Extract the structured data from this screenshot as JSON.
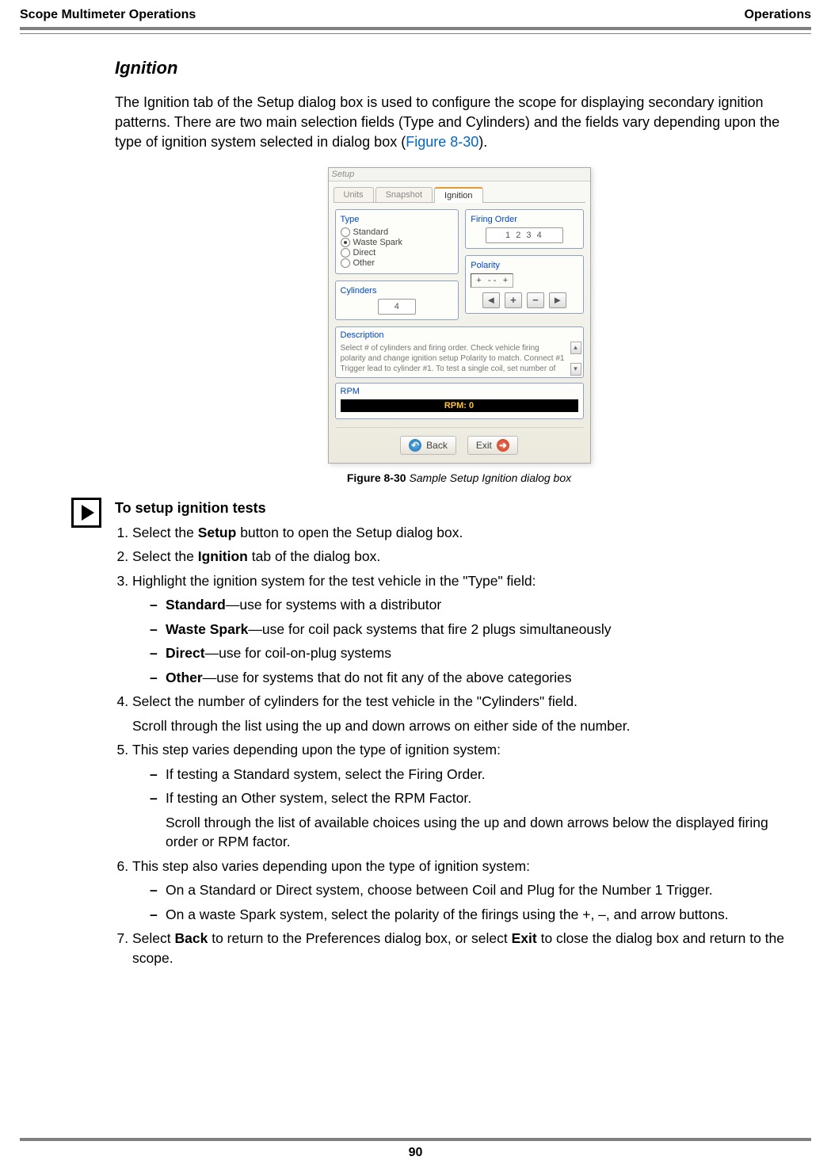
{
  "header": {
    "left": "Scope Multimeter Operations",
    "right": "Operations"
  },
  "section": {
    "title": "Ignition"
  },
  "intro": {
    "text_before_link": "The Ignition tab of the Setup dialog box is used to configure the scope for displaying secondary ignition patterns. There are two main selection fields (Type and Cylinders) and the fields vary depending upon the type of ignition system selected in dialog box (",
    "link": "Figure 8-30",
    "text_after_link": ")."
  },
  "figure": {
    "caption_label": "Figure 8-30",
    "caption_text": "Sample Setup Ignition dialog box",
    "dialog": {
      "title": "Setup",
      "tabs": [
        "Units",
        "Snapshot",
        "Ignition"
      ],
      "active_tab": "Ignition",
      "type_group": {
        "label": "Type",
        "options": [
          "Standard",
          "Waste Spark",
          "Direct",
          "Other"
        ],
        "selected": "Waste Spark"
      },
      "cylinders": {
        "label": "Cylinders",
        "value": "4"
      },
      "firing_order": {
        "label": "Firing Order",
        "value": "1 2 3 4"
      },
      "polarity": {
        "label": "Polarity",
        "pattern_left": "+",
        "pattern_mid": "- -",
        "pattern_right": "+",
        "nav": {
          "left": "◄",
          "plus": "+",
          "minus": "−",
          "right": "►"
        }
      },
      "description": {
        "label": "Description",
        "text": "Select # of cylinders and firing order. Check vehicle firing polarity and change ignition setup Polarity to match. Connect #1 Trigger lead to cylinder #1. To test a single coil, set number of"
      },
      "rpm": {
        "label": "RPM",
        "display": "RPM: 0"
      },
      "footer": {
        "back": "Back",
        "exit": "Exit"
      }
    }
  },
  "procedure": {
    "title": "To setup ignition tests",
    "steps": {
      "s1": {
        "before": "Select the ",
        "bold": "Setup",
        "after": " button to open the Setup dialog box."
      },
      "s2": {
        "before": "Select the ",
        "bold": "Ignition",
        "after": " tab of the dialog box."
      },
      "s3": {
        "text": "Highlight the ignition system for the test vehicle in the \"Type\" field:",
        "items": {
          "a": {
            "bold": "Standard",
            "after": "—use for systems with a distributor"
          },
          "b": {
            "bold": "Waste Spark",
            "after": "—use for coil pack systems that fire 2 plugs simultaneously"
          },
          "c": {
            "bold": "Direct",
            "after": "—use for coil-on-plug systems"
          },
          "d": {
            "bold": "Other",
            "after": "—use for systems that do not fit any of the above categories"
          }
        }
      },
      "s4": {
        "line1": "Select the number of cylinders for the test vehicle in the \"Cylinders\" field.",
        "line2": "Scroll through the list using the up and down arrows on either side of the number."
      },
      "s5": {
        "text": "This step varies depending upon the type of ignition system:",
        "items": {
          "a": {
            "text": "If testing a Standard system, select the Firing Order."
          },
          "b": {
            "text": "If testing an Other system, select the RPM Factor.",
            "extra": "Scroll through the list of available choices using the up and down arrows below the displayed firing order or RPM factor."
          }
        }
      },
      "s6": {
        "text": "This step also varies depending upon the type of ignition system:",
        "items": {
          "a": {
            "text": "On a Standard or Direct system, choose between Coil and Plug for the Number 1 Trigger."
          },
          "b": {
            "text": "On a waste Spark system, select the polarity of the firings using the +, –, and arrow buttons."
          }
        }
      },
      "s7": {
        "before": "Select ",
        "bold1": "Back",
        "mid": " to return to the Preferences dialog box, or select ",
        "bold2": "Exit",
        "after": " to close the dialog box and return to the scope."
      }
    }
  },
  "page_number": "90"
}
